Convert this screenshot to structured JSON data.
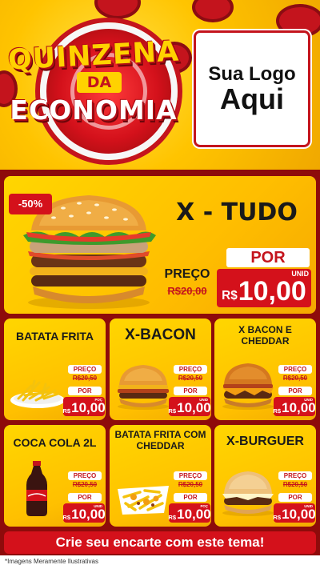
{
  "header": {
    "title_line1": "QUINZENA",
    "title_line2": "DA",
    "title_line3": "ECONOMIA",
    "logo_line1": "Sua Logo",
    "logo_line2": "Aqui"
  },
  "hero": {
    "badge": "-50%",
    "product": "X - TUDO",
    "preco_label": "PREÇO",
    "old_price": "R$20,00",
    "por_label": "POR",
    "currency": "R$",
    "new_price": "10,00",
    "unit": "UNID"
  },
  "cards": [
    {
      "title": "BATATA FRITA",
      "preco_label": "PREÇO",
      "old_price": "R$20,50",
      "por_label": "POR",
      "currency": "R$",
      "new_price": "10,00",
      "unit": "POÇ",
      "icon": "fries-icon"
    },
    {
      "title": "X-BACON",
      "preco_label": "PREÇO",
      "old_price": "R$20,50",
      "por_label": "POR",
      "currency": "R$",
      "new_price": "10,00",
      "unit": "UNID",
      "icon": "burger-icon"
    },
    {
      "title": "X BACON E CHEDDAR",
      "preco_label": "PREÇO",
      "old_price": "R$20,50",
      "por_label": "POR",
      "currency": "R$",
      "new_price": "10,00",
      "unit": "UNID",
      "icon": "burger-icon"
    },
    {
      "title": "COCA COLA 2L",
      "preco_label": "PREÇO",
      "old_price": "R$20,50",
      "por_label": "POR",
      "currency": "R$",
      "new_price": "10,00",
      "unit": "UNID",
      "icon": "soda-bottle-icon"
    },
    {
      "title": "BATATA FRITA COM CHEDDAR",
      "preco_label": "PREÇO",
      "old_price": "R$20,50",
      "por_label": "POR",
      "currency": "R$",
      "new_price": "10,00",
      "unit": "POÇ",
      "icon": "cheese-fries-icon"
    },
    {
      "title": "X-BURGUER",
      "preco_label": "PREÇO",
      "old_price": "R$20,50",
      "por_label": "POR",
      "currency": "R$",
      "new_price": "10,00",
      "unit": "UNID",
      "icon": "burger-icon"
    }
  ],
  "footer": {
    "cta": "Crie seu encarte com este tema!",
    "disclaimer": "*Imagens Meramente Ilustrativas"
  },
  "colors": {
    "brand_red": "#d4111b",
    "brand_yellow": "#ffc400",
    "background_dark_red": "#8e0b0b"
  }
}
